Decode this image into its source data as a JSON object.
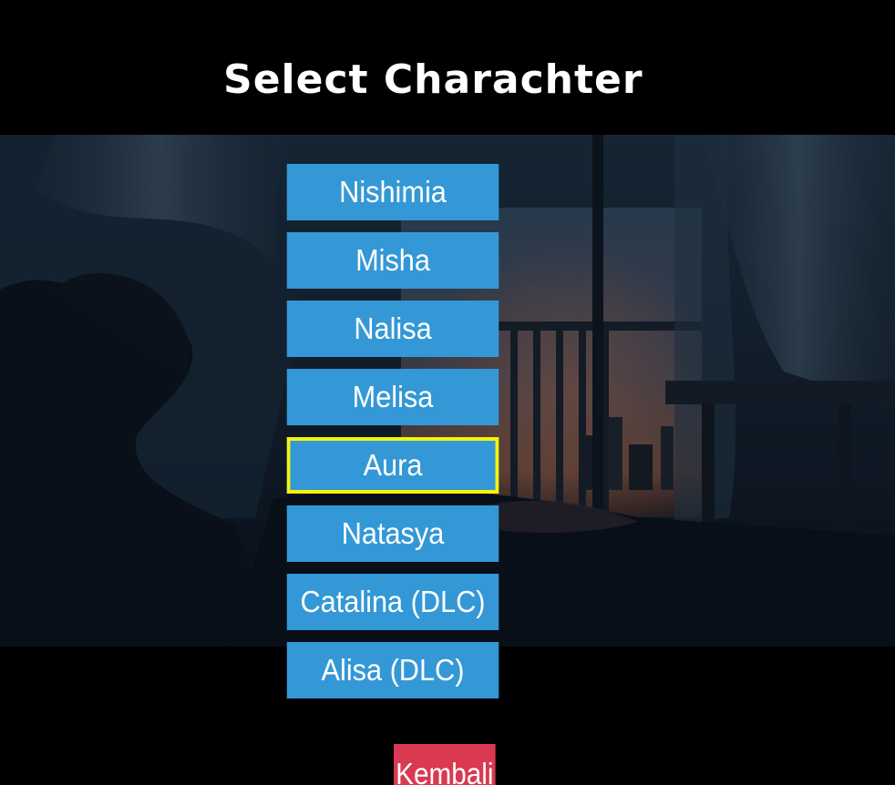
{
  "title": "Select Charachter",
  "characters": [
    {
      "label": "Nishimia"
    },
    {
      "label": "Misha"
    },
    {
      "label": "Nalisa"
    },
    {
      "label": "Melisa"
    },
    {
      "label": "Aura",
      "selected": true
    },
    {
      "label": "Natasya"
    },
    {
      "label": "Catalina (DLC)"
    },
    {
      "label": "Alisa (DLC)"
    }
  ],
  "back_label": "Kembali",
  "colors": {
    "button": "#3498d6",
    "selected_border": "#f4f40a",
    "back_button": "#d93a52",
    "background": "#000000"
  }
}
